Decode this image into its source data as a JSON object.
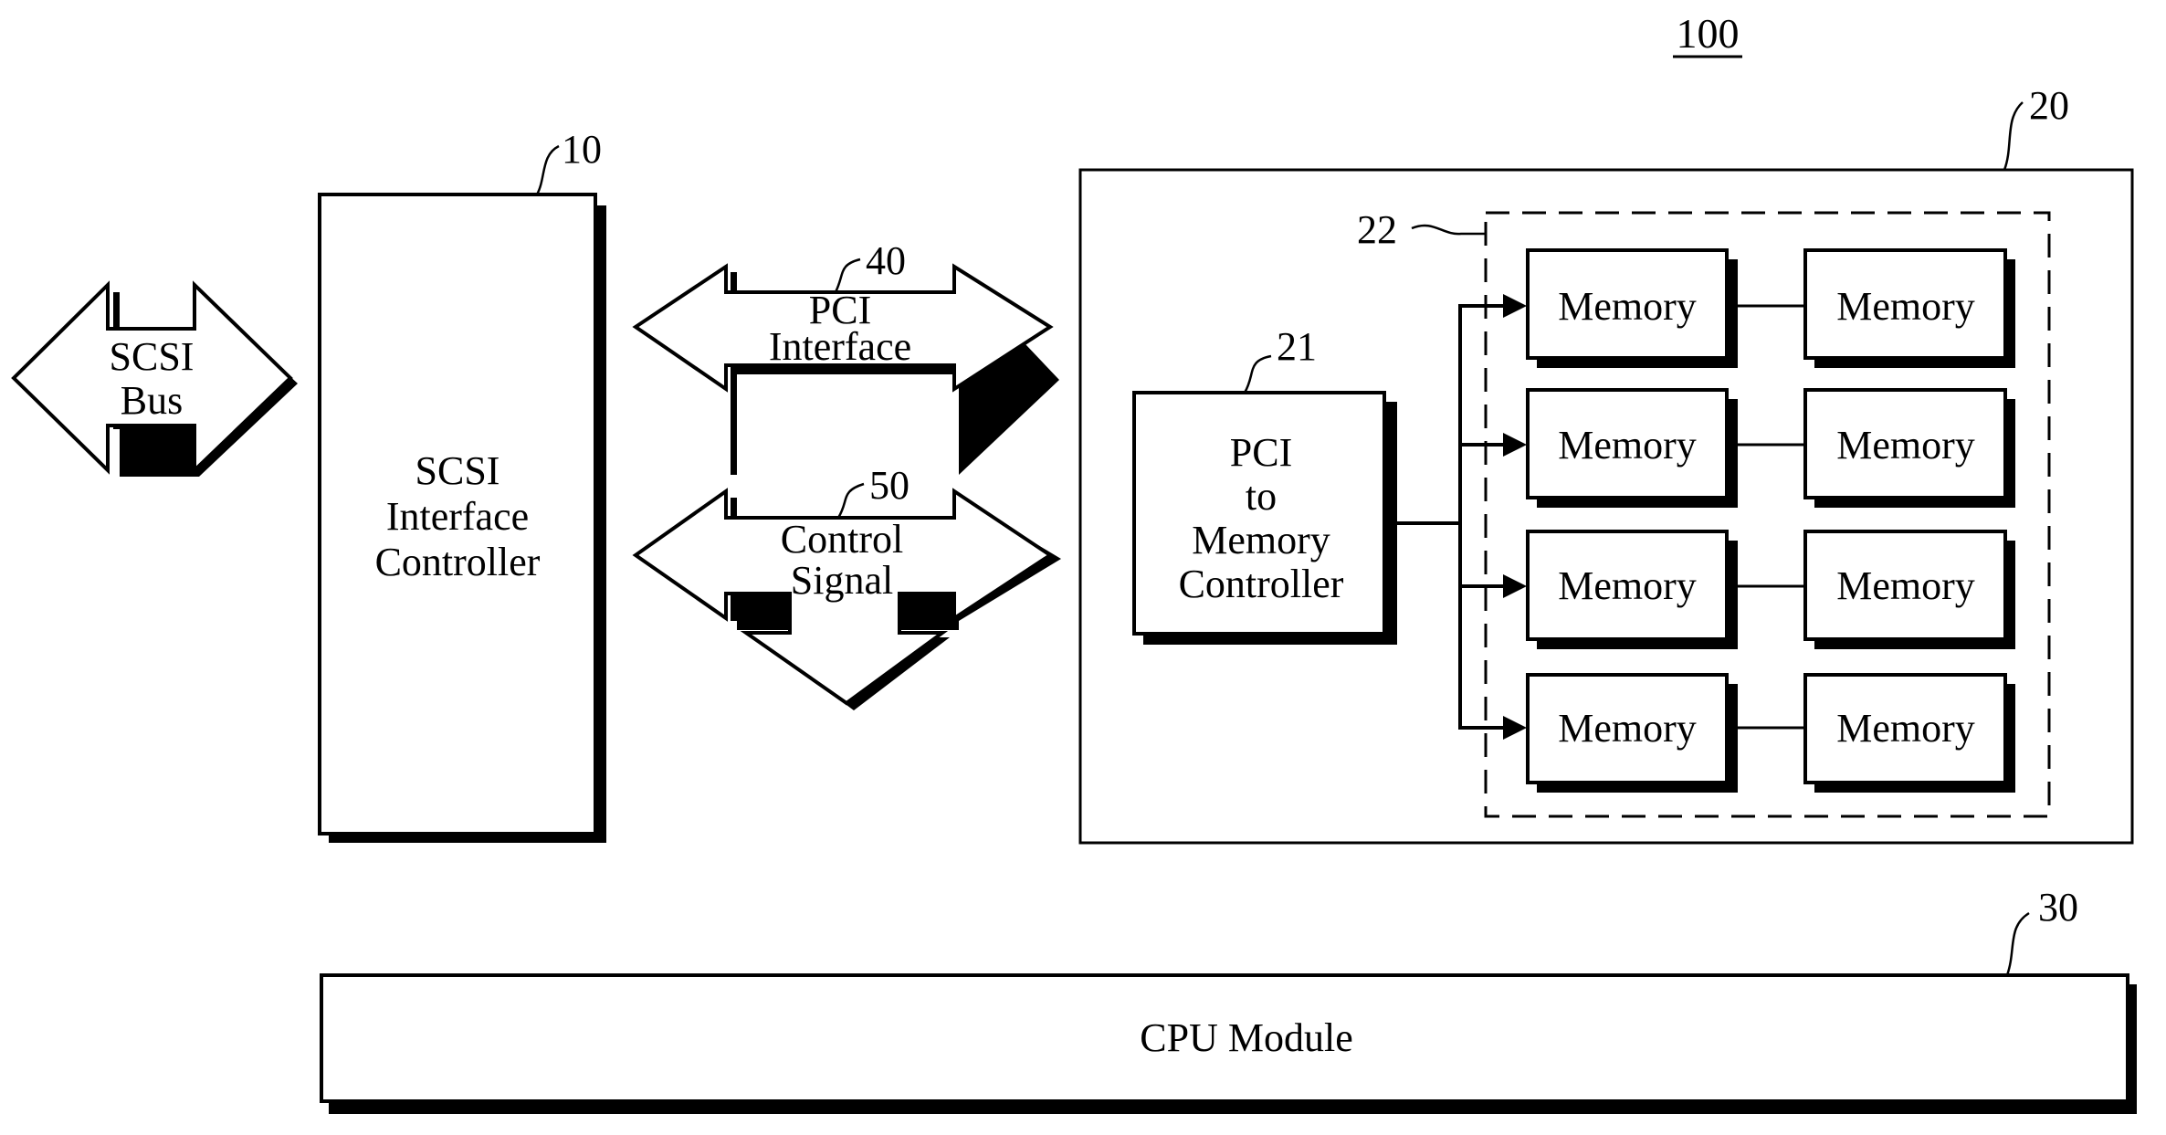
{
  "figure": {
    "reference_numeral": "100"
  },
  "scsi_bus": {
    "lines": [
      "SCSI",
      "Bus"
    ]
  },
  "scsi_controller": {
    "ref": "10",
    "lines": [
      "SCSI",
      "Interface",
      "Controller"
    ]
  },
  "pci_interface": {
    "ref": "40",
    "lines": [
      "PCI",
      "Interface"
    ]
  },
  "control_signal": {
    "ref": "50",
    "lines": [
      "Control",
      "Signal"
    ]
  },
  "memory_module": {
    "ref": "20",
    "controller": {
      "ref": "21",
      "lines": [
        "PCI",
        "to",
        "Memory",
        "Controller"
      ]
    },
    "memory_group": {
      "ref": "22",
      "rows": [
        [
          "Memory",
          "Memory"
        ],
        [
          "Memory",
          "Memory"
        ],
        [
          "Memory",
          "Memory"
        ],
        [
          "Memory",
          "Memory"
        ]
      ]
    }
  },
  "cpu_module": {
    "ref": "30",
    "label": "CPU Module"
  }
}
